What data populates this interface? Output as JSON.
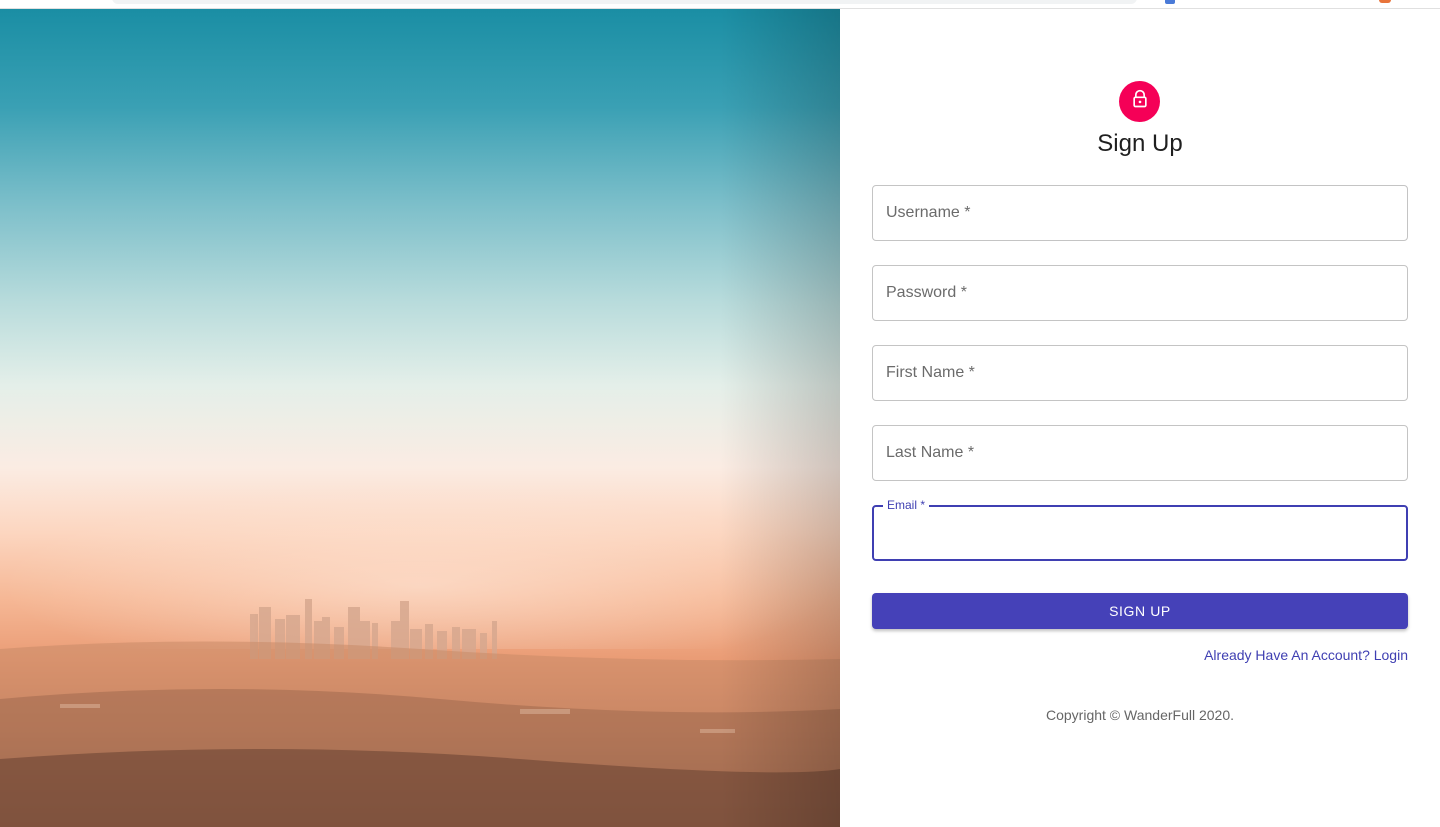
{
  "signup": {
    "title": "Sign Up",
    "fields": [
      {
        "label": "Username *",
        "value": ""
      },
      {
        "label": "Password *",
        "value": ""
      },
      {
        "label": "First Name *",
        "value": ""
      },
      {
        "label": "Last Name *",
        "value": ""
      },
      {
        "label": "Email *",
        "value": ""
      }
    ],
    "submit_label": "SIGN UP",
    "login_link": "Already Have An Account? Login",
    "copyright": "Copyright © WanderFull 2020."
  },
  "icons": {
    "avatar": "lock-icon"
  },
  "colors": {
    "primary": "#4541b8",
    "secondary": "#f50057",
    "focus": "#3f3fb2"
  }
}
